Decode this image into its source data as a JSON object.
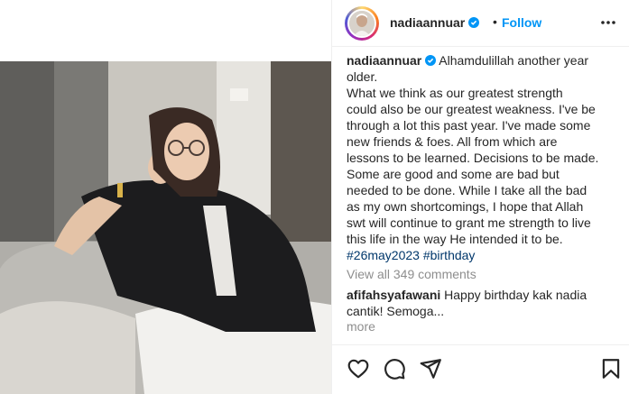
{
  "post": {
    "username": "nadiaannuar",
    "header_separator": "•",
    "follow_label": "Follow",
    "more_icon": "more-options-icon",
    "verified_icon": "verified-badge-icon"
  },
  "caption": {
    "username": "nadiaannuar",
    "lines": [
      "Alhamdulillah another year",
      "older.",
      "What we think as our greatest strength",
      "could also be our greatest weakness. I've be",
      "through a lot this past year. I've made some",
      "new friends & foes. All from which are",
      "lessons to be learned. Decisions to be made.",
      "Some are good and some are bad but",
      "needed to be done. While I take all the bad",
      "as my own shortcomings, I hope that Allah",
      "swt will continue to grant me strength to live",
      "this life in the way He intended it to be."
    ],
    "hashtags": "#26may2023 #birthday"
  },
  "comments": {
    "view_all": "View all 349 comments",
    "first": {
      "username": "afifahsyafawani",
      "text_line1": "Happy birthday kak nadia",
      "text_line2": "cantik! Semoga...",
      "more": "more"
    }
  },
  "actions": {
    "like_icon": "heart-icon",
    "comment_icon": "comment-icon",
    "share_icon": "share-icon",
    "save_icon": "bookmark-icon"
  },
  "colors": {
    "link_blue": "#0095f6",
    "hashtag": "#00376b",
    "muted": "#8e8e8e",
    "text": "#262626"
  }
}
